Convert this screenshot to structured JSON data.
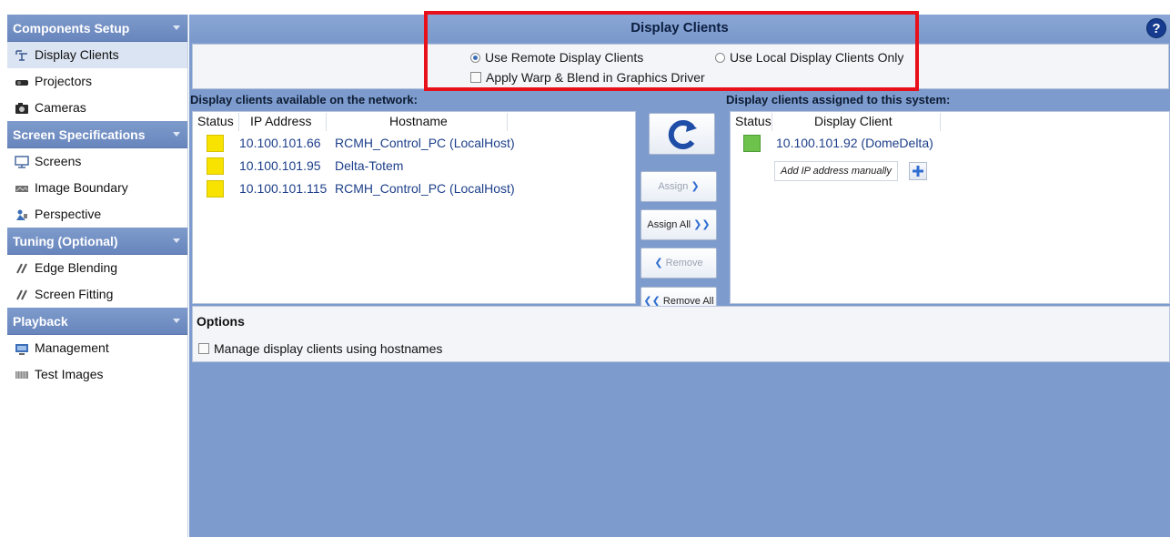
{
  "sidebar": {
    "sections": [
      {
        "title": "Components Setup",
        "items": [
          {
            "label": "Display Clients",
            "icon": "display-clients-icon",
            "selected": true
          },
          {
            "label": "Projectors",
            "icon": "projector-icon"
          },
          {
            "label": "Cameras",
            "icon": "camera-icon"
          }
        ]
      },
      {
        "title": "Screen Specifications",
        "items": [
          {
            "label": "Screens",
            "icon": "screen-icon"
          },
          {
            "label": "Image Boundary",
            "icon": "image-boundary-icon"
          },
          {
            "label": "Perspective",
            "icon": "perspective-icon"
          }
        ]
      },
      {
        "title": "Tuning (Optional)",
        "items": [
          {
            "label": "Edge Blending",
            "icon": "edge-blending-icon"
          },
          {
            "label": "Screen Fitting",
            "icon": "screen-fitting-icon"
          }
        ]
      },
      {
        "title": "Playback",
        "items": [
          {
            "label": "Management",
            "icon": "management-icon"
          },
          {
            "label": "Test Images",
            "icon": "test-images-icon"
          }
        ]
      }
    ]
  },
  "header": {
    "title": "Display Clients",
    "help": "?"
  },
  "mode": {
    "remote_label": "Use Remote Display Clients",
    "local_label": "Use Local Display Clients Only",
    "warp_label": "Apply Warp & Blend in Graphics Driver",
    "selected": "remote"
  },
  "available": {
    "label": "Display clients available on the network:",
    "columns": [
      "Status",
      "IP Address",
      "Hostname"
    ],
    "rows": [
      {
        "status_color": "#f7e200",
        "ip": "10.100.101.66",
        "hostname": "RCMH_Control_PC (LocalHost)"
      },
      {
        "status_color": "#f7e200",
        "ip": "10.100.101.95",
        "hostname": "Delta-Totem"
      },
      {
        "status_color": "#f7e200",
        "ip": "10.100.101.115",
        "hostname": "RCMH_Control_PC (LocalHost)"
      }
    ]
  },
  "assigned": {
    "label": "Display clients assigned to this system:",
    "columns": [
      "Status",
      "Display Client"
    ],
    "rows": [
      {
        "status_color": "#6cc24a",
        "client": "10.100.101.92 (DomeDelta)"
      }
    ],
    "add_placeholder": "Add IP address manually"
  },
  "buttons": {
    "assign": "Assign",
    "assign_all": "Assign All",
    "remove": "Remove",
    "remove_all": "Remove All"
  },
  "options": {
    "title": "Options",
    "hostnames_label": "Manage display clients using hostnames"
  },
  "colors": {
    "accent": "#7d9bcd",
    "highlight_box": "#e8101a",
    "link_text": "#1d3f8a"
  }
}
